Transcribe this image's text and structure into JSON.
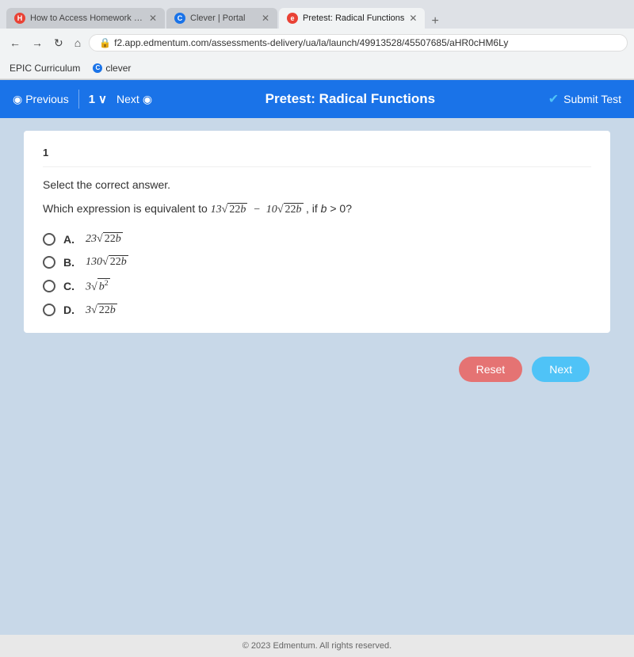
{
  "browser": {
    "tabs": [
      {
        "id": "tab1",
        "title": "How to Access Homework Help",
        "icon": "circle",
        "icon_letter": "H",
        "icon_color": "red",
        "active": false
      },
      {
        "id": "tab2",
        "title": "Clever | Portal",
        "icon": "circle",
        "icon_letter": "C",
        "icon_color": "blue",
        "active": false
      },
      {
        "id": "tab3",
        "title": "Pretest: Radical Functions",
        "icon": "circle",
        "icon_letter": "e",
        "icon_color": "red",
        "active": true
      }
    ],
    "address": "f2.app.edmentum.com/assessments-delivery/ua/la/launch/49913528/45507685/aHR0cHM6Ly",
    "bookmarks": [
      {
        "label": "EPIC Curriculum"
      },
      {
        "label": "clever",
        "icon_color": "blue"
      }
    ]
  },
  "toolbar": {
    "previous_label": "Previous",
    "question_number": "1",
    "next_label": "Next",
    "title": "Pretest: Radical Functions",
    "submit_label": "Submit Test"
  },
  "question": {
    "number": "1",
    "instruction": "Select the correct answer.",
    "text": "Which expression is equivalent to 13√22b − 10√22b, if b > 0?",
    "options": [
      {
        "id": "A",
        "label": "A.",
        "expr": "23√22b"
      },
      {
        "id": "B",
        "label": "B.",
        "expr": "130√22b"
      },
      {
        "id": "C",
        "label": "C.",
        "expr": "3√b²"
      },
      {
        "id": "D",
        "label": "D.",
        "expr": "3√22b"
      }
    ]
  },
  "actions": {
    "reset_label": "Reset",
    "next_label": "Next"
  },
  "footer": {
    "text": "© 2023 Edmentum. All rights reserved."
  }
}
